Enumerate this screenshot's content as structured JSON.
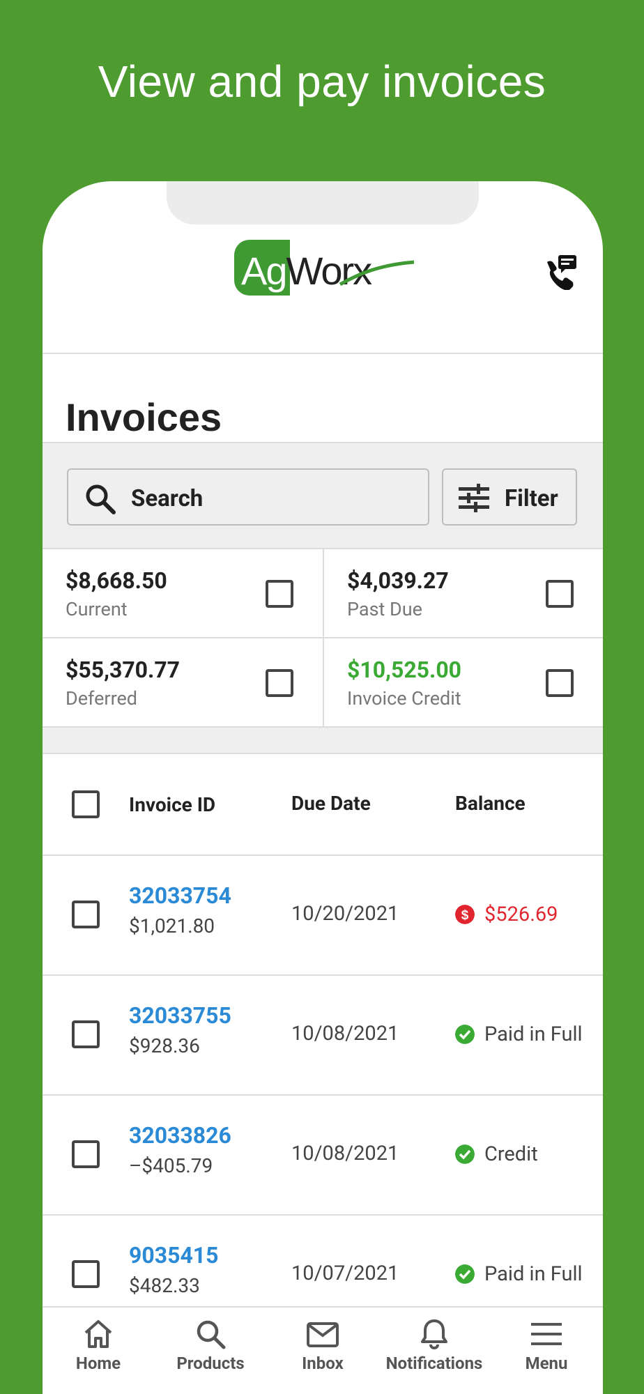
{
  "promo": {
    "title": "View and pay invoices"
  },
  "header": {
    "logo_part1": "Ag",
    "logo_part2": "Worx"
  },
  "page": {
    "title": "Invoices"
  },
  "toolbar": {
    "search_placeholder": "Search",
    "filter_label": "Filter"
  },
  "summary": [
    {
      "amount": "$8,668.50",
      "label": "Current",
      "checked": false
    },
    {
      "amount": "$4,039.27",
      "label": "Past Due",
      "checked": false
    },
    {
      "amount": "$55,370.77",
      "label": "Deferred",
      "checked": false
    },
    {
      "amount": "$10,525.00",
      "label": "Invoice Credit",
      "checked": false
    }
  ],
  "table": {
    "columns": [
      "Invoice ID",
      "Due Date",
      "Balance"
    ],
    "rows": [
      {
        "id": "32033754",
        "amount": "$1,021.80",
        "due": "10/20/2021",
        "balance": "$526.69",
        "status": "due"
      },
      {
        "id": "32033755",
        "amount": "$928.36",
        "due": "10/08/2021",
        "balance": "Paid in Full",
        "status": "paid"
      },
      {
        "id": "32033826",
        "amount": "–$405.79",
        "due": "10/08/2021",
        "balance": "Credit",
        "status": "paid"
      },
      {
        "id": "9035415",
        "amount": "$482.33",
        "due": "10/07/2021",
        "balance": "Paid in Full",
        "status": "paid"
      }
    ]
  },
  "nav": [
    {
      "label": "Home",
      "icon": "home-icon"
    },
    {
      "label": "Products",
      "icon": "search-icon"
    },
    {
      "label": "Inbox",
      "icon": "mail-icon"
    },
    {
      "label": "Notifications",
      "icon": "bell-icon"
    },
    {
      "label": "Menu",
      "icon": "menu-icon"
    }
  ],
  "colors": {
    "brand_green": "#4e9c2f",
    "link_blue": "#2b8ad6",
    "due_red": "#e0252e",
    "paid_green": "#3aaa35"
  }
}
